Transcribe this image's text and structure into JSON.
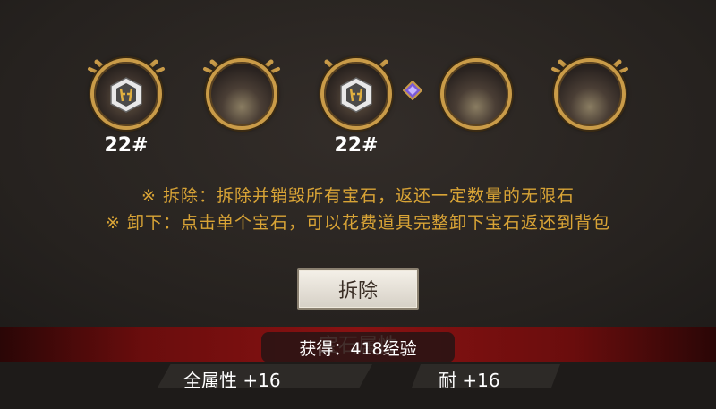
{
  "slots": [
    {
      "filled": true,
      "level": "22#"
    },
    {
      "filled": false,
      "level": ""
    },
    {
      "filled": true,
      "level": "22#"
    },
    {
      "filled": false,
      "level": ""
    },
    {
      "filled": false,
      "level": ""
    }
  ],
  "notes": {
    "line1": "※ 拆除：拆除并销毁所有宝石，返还一定数量的无限石",
    "line2": "※ 卸下：点击单个宝石，可以花费道具完整卸下宝石返还到背包"
  },
  "button": {
    "label": "拆除"
  },
  "section_title": "宝石属性",
  "toast": "获得：418经验",
  "stats": {
    "left": "全属性 +16",
    "right": "耐 +16"
  },
  "colors": {
    "gold": "#c99b48",
    "note_text": "#d9a436",
    "strip_red": "#8a1212"
  }
}
